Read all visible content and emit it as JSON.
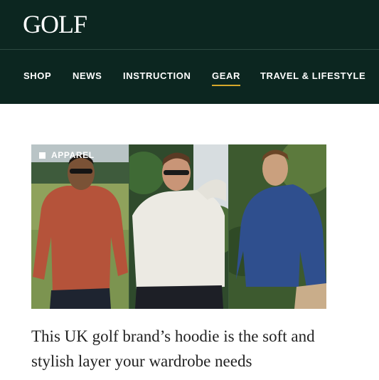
{
  "header": {
    "logo": "GOLF",
    "nav": [
      {
        "label": "SHOP",
        "active": false
      },
      {
        "label": "NEWS",
        "active": false
      },
      {
        "label": "INSTRUCTION",
        "active": false
      },
      {
        "label": "GEAR",
        "active": true
      },
      {
        "label": "TRAVEL & LIFESTYLE",
        "active": false
      }
    ]
  },
  "article": {
    "category": "APPAREL",
    "headline": "This UK golf brand’s hoodie is the soft and stylish layer your wardrobe needs",
    "image_panels": [
      {
        "subject": "man in rust-red hoodie",
        "hoodie_color": "#b5533a"
      },
      {
        "subject": "man in cream hoodie",
        "hoodie_color": "#eceae3"
      },
      {
        "subject": "man in navy hoodie",
        "hoodie_color": "#2f4f8e"
      }
    ]
  },
  "colors": {
    "header_bg": "#0c2620",
    "accent_underline": "#d6a82b",
    "text_dark": "#222222"
  }
}
